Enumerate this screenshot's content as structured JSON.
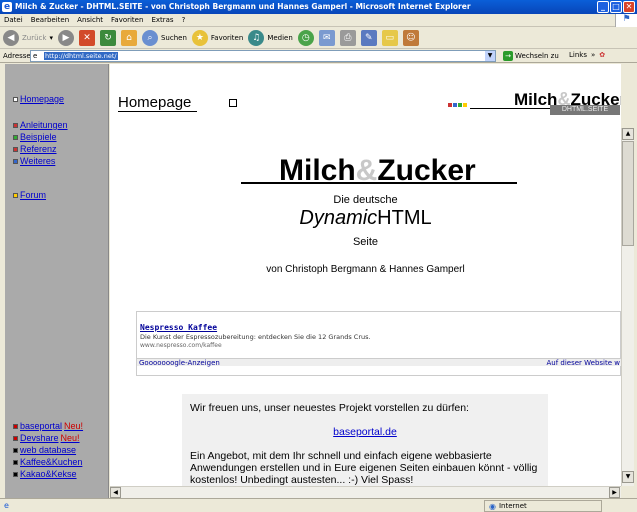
{
  "window": {
    "title": "Milch & Zucker - DHTML.SEITE - von Christoph Bergmann und Hannes Gamperl - Microsoft Internet Explorer"
  },
  "menu": [
    "Datei",
    "Bearbeiten",
    "Ansicht",
    "Favoriten",
    "Extras",
    "?"
  ],
  "toolbar": {
    "back": "Zurück",
    "search": "Suchen",
    "favorites": "Favoriten",
    "media": "Medien"
  },
  "address": {
    "label": "Adresse",
    "url": "http://dhtml.seite.net/",
    "go": "Wechseln zu",
    "links": "Links"
  },
  "left_nav": {
    "top": [
      {
        "label": "Homepage",
        "color": "#ffffff"
      },
      {
        "label": "Anleitungen",
        "color": "#cc3333"
      },
      {
        "label": "Beispiele",
        "color": "#33aa33"
      },
      {
        "label": "Referenz",
        "color": "#cc3333"
      },
      {
        "label": "Weiteres",
        "color": "#3366cc"
      },
      {
        "label": "Forum",
        "color": "#ffcc00"
      }
    ],
    "bottom": [
      {
        "label": "baseportal",
        "neu": "Neu!",
        "color": "#cc0000"
      },
      {
        "label": "Devshare",
        "neu": "Neu!",
        "color": "#cc0000"
      },
      {
        "label": "web database",
        "neu": "",
        "color": "#000000"
      },
      {
        "label": "Kaffee&Kuchen",
        "neu": "",
        "color": "#000000"
      },
      {
        "label": "Kakao&Kekse",
        "neu": "",
        "color": "#000000"
      }
    ]
  },
  "main": {
    "homepage_label": "Homepage",
    "logo_small": {
      "part1": "Milch",
      "amp": "&",
      "part2": "Zucker",
      "sub": "DHTML.SEITE"
    },
    "logo_big": {
      "part1": "Milch",
      "amp": "&",
      "part2": "Zucker"
    },
    "subtitle1": "Die deutsche",
    "subtitle2a": "Dynamic",
    "subtitle2b": "HTML",
    "subtitle3": "Seite",
    "authors": "von Christoph Bergmann & Hannes Gamperl",
    "ad": {
      "title": "Nespresso Kaffee",
      "desc": "Die Kunst der Espressozubereitung: entdecken Sie die 12 Grands Crus.",
      "url": "www.nespresso.com/kaffee",
      "footer_left": "Gooooooogle-Anzeigen",
      "footer_right": "Auf dieser Website w"
    },
    "box": {
      "line1": "Wir freuen uns, unser neuestes Projekt vorstellen zu dürfen:",
      "link": "baseportal.de",
      "line2": "Ein Angebot, mit dem Ihr schnell und einfach eigene webbasierte Anwendungen erstellen und in Eure eigenen Seiten einbauen könnt - völlig kostenlos! Unbedingt austesten... :-) Viel Spass!"
    }
  },
  "status": {
    "zone": "Internet"
  }
}
